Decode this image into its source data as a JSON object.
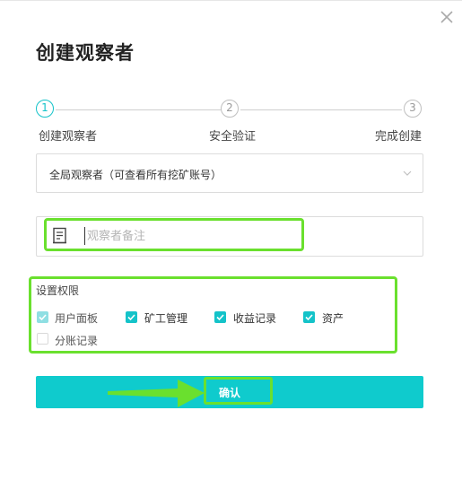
{
  "dialog": {
    "title": "创建观察者"
  },
  "steps": [
    {
      "number": "1",
      "label": "创建观察者",
      "state": "active"
    },
    {
      "number": "2",
      "label": "安全验证",
      "state": "pending"
    },
    {
      "number": "3",
      "label": "完成创建",
      "state": "pending"
    }
  ],
  "observer_type": {
    "selected": "全局观察者（可查看所有挖矿账号）"
  },
  "note": {
    "placeholder": "观察者备注",
    "value": ""
  },
  "permissions": {
    "title": "设置权限",
    "items": [
      {
        "label": "用户面板",
        "checked": true,
        "disabled": true
      },
      {
        "label": "矿工管理",
        "checked": true
      },
      {
        "label": "收益记录",
        "checked": true
      },
      {
        "label": "资产",
        "checked": true
      },
      {
        "label": "分账记录",
        "checked": false,
        "disabled": true
      }
    ]
  },
  "confirm": {
    "label": "确认"
  },
  "colors": {
    "accent": "#14c3c9",
    "button": "#0fcbcd",
    "highlight": "#6ae02e"
  }
}
